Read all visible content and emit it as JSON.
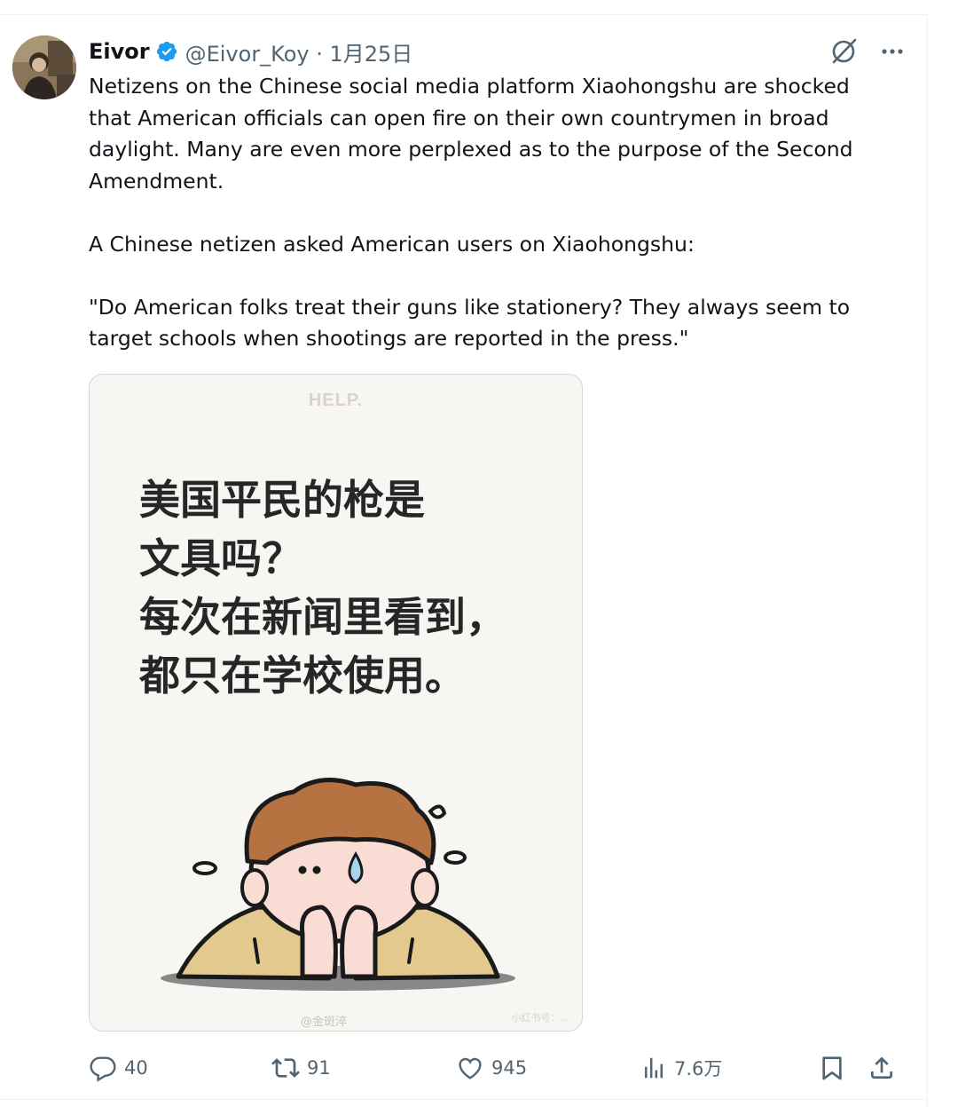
{
  "tweet": {
    "author_name": "Eivor",
    "handle_line": "@Eivor_Koy · 1月25日",
    "paragraphs": [
      "Netizens on the Chinese social media platform Xiaohongshu are shocked that American officials can open fire on their own countrymen in broad daylight. Many are even more perplexed as to the purpose of the Second Amendment.",
      "A Chinese netizen asked American users on Xiaohongshu:",
      "\"Do American folks treat their guns like stationery? They always seem to target schools when shootings are reported in the press.\""
    ],
    "media": {
      "help_text": "HELP.",
      "lines": [
        "美国平民的枪是",
        "文具吗？",
        "每次在新闻里看到，",
        "都只在学校使用。"
      ],
      "watermark": "@金斑淬",
      "watermark_right": "小红书号：..."
    },
    "stats": {
      "replies": "40",
      "reposts": "91",
      "likes": "945",
      "views": "7.6万"
    }
  },
  "icons": {
    "verified": "verified-badge-icon",
    "grok": "grok-icon",
    "more": "more-icon",
    "reply": "reply-icon",
    "repost": "repost-icon",
    "like": "like-icon",
    "views": "views-icon",
    "bookmark": "bookmark-icon",
    "share": "share-icon"
  },
  "colors": {
    "verified": "#1d9bf0",
    "text": "#0f1419",
    "muted": "#536471"
  }
}
